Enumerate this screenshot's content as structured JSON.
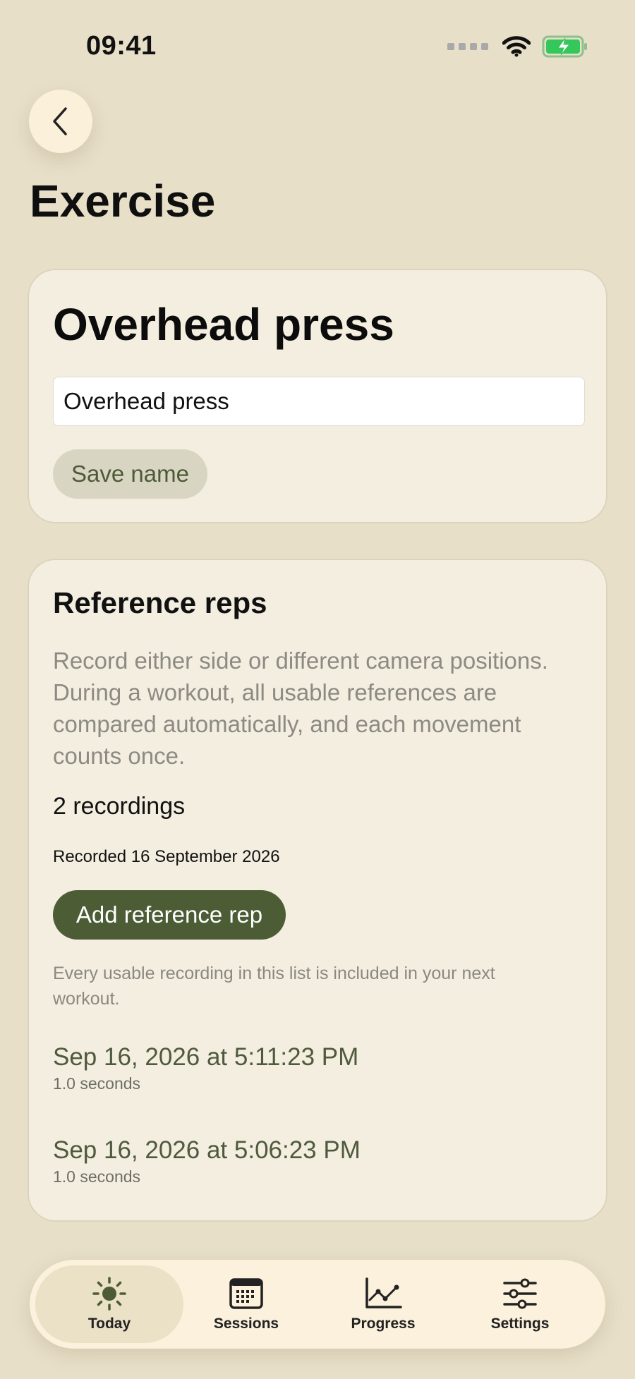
{
  "status_bar": {
    "time": "09:41"
  },
  "header": {
    "title": "Exercise"
  },
  "exercise": {
    "name": "Overhead press",
    "input_value": "Overhead press",
    "save_label": "Save name"
  },
  "references": {
    "title": "Reference reps",
    "description": "Record either side or different camera positions. During a workout, all usable references are compared automatically, and each movement counts once.",
    "count_label": "2 recordings",
    "recorded_label": "Recorded 16 September 2026",
    "add_label": "Add reference rep",
    "hint": "Every usable recording in this list is included in your next workout.",
    "recordings": [
      {
        "title": "Sep 16, 2026 at 5:11:23 PM",
        "duration": "1.0 seconds"
      },
      {
        "title": "Sep 16, 2026 at 5:06:23 PM",
        "duration": "1.0 seconds"
      }
    ]
  },
  "tabs": [
    {
      "label": "Today",
      "icon": "sun-icon",
      "active": true
    },
    {
      "label": "Sessions",
      "icon": "calendar-icon",
      "active": false
    },
    {
      "label": "Progress",
      "icon": "chart-line-icon",
      "active": false
    },
    {
      "label": "Settings",
      "icon": "sliders-icon",
      "active": false
    }
  ],
  "colors": {
    "background": "#e7dfc8",
    "card": "#f3eee0",
    "accent": "#4c5c35",
    "accent_text": "#4f5a3c",
    "muted_text": "#8c8a83",
    "tab_bar": "#fbf1dc",
    "battery": "#34c759"
  }
}
